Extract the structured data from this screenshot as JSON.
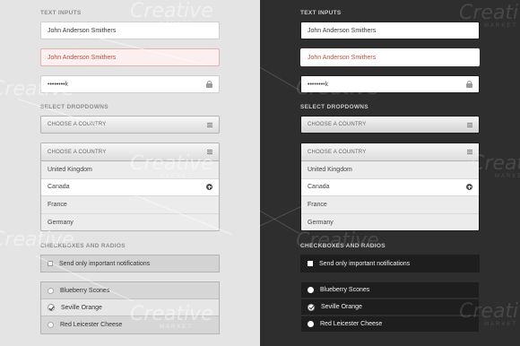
{
  "sections": {
    "text_inputs": "TEXT INPUTS",
    "select_dropdowns": "SELECT DROPDOWNS",
    "checkboxes_radios": "CHECKBOXES AND RADIOS"
  },
  "inputs": {
    "name_value": "John Anderson Smithers",
    "name_error_value": "John Anderson Smithers",
    "password_value": "••••••••k"
  },
  "selects": {
    "collapsed_label": "CHOOSE A COUNTRY",
    "open_label": "CHOOSE A COUNTRY",
    "options": [
      "United Kingdom",
      "Canada",
      "France",
      "Germany"
    ],
    "selected": "Canada"
  },
  "checkbox": {
    "label": "Send only important notifications"
  },
  "radios": {
    "options": [
      "Blueberry Scones",
      "Seville Orange",
      "Red Leicester Cheese"
    ],
    "selected": "Seville Orange"
  },
  "watermark": {
    "brand": "Creative",
    "sub": "MARKET"
  },
  "colors": {
    "light_bg": "#e4e4e4",
    "dark_bg": "#2e2e2e",
    "error_text": "#b5503f",
    "error_border": "#e8b2ab"
  }
}
